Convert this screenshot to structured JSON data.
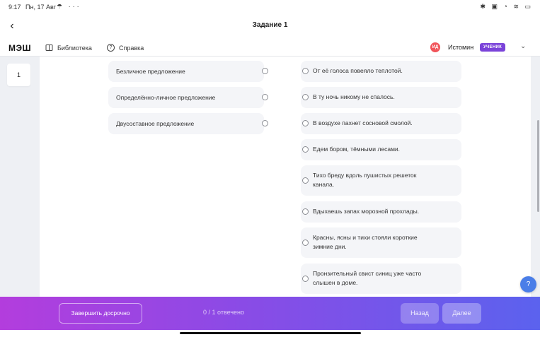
{
  "status_bar": {
    "time": "9:17",
    "date": "Пн, 17 Авг",
    "left_icons": "☂ ···",
    "right_icons": "✱ ▣ ◔ ≋ ▭"
  },
  "title_bar": {
    "title": "Задание 1",
    "back_icon": "‹"
  },
  "nav": {
    "logo": "МЭШ",
    "library_label": "Библиотека",
    "help_label": "Справка",
    "avatar_initials": "ИД",
    "username": "Истомин",
    "role_badge": "УЧЕНИК",
    "chevron": "⌄"
  },
  "question_number": "1",
  "left_options": [
    {
      "label": "Безличное предложение"
    },
    {
      "label": "Определённо-личное предложение"
    },
    {
      "label": "Двусоставное предложение"
    }
  ],
  "right_options": [
    {
      "label": "От её голоса повеяло теплотой."
    },
    {
      "label": "В ту ночь никому не спалось."
    },
    {
      "label": "В воздухе пахнет сосновой смолой."
    },
    {
      "label": "Едем бором, тёмными лесами."
    },
    {
      "label": "Тихо бреду вдоль пушистых решеток канала."
    },
    {
      "label": "Вдыхаешь запах морозной прохлады."
    },
    {
      "label": "Красны, ясны и тихи стояли короткие зимние дни."
    },
    {
      "label": "Пронзительный свист синиц уже часто слышен в доме."
    }
  ],
  "footer": {
    "finish_label": "Завершить досрочно",
    "progress_text": "0 / 1 отвечено",
    "back_label": "Назад",
    "next_label": "Далее"
  },
  "help_fab": "?",
  "colors": {
    "accent_purple": "#7a43d9",
    "footer_gradient_start": "#b33ddd",
    "footer_gradient_end": "#5b62ee",
    "help_fab": "#4a7ee8",
    "avatar": "#f1545a"
  }
}
